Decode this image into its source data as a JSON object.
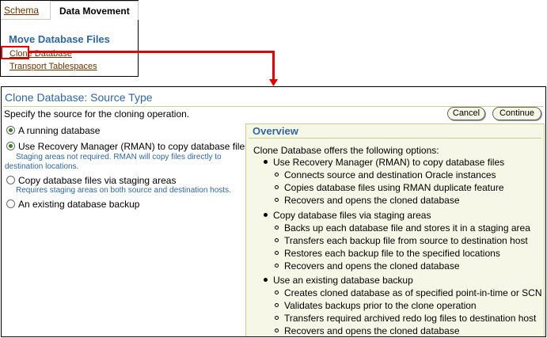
{
  "inset": {
    "tabs": [
      "Schema",
      "Data Movement"
    ],
    "heading": "Move Database Files",
    "links": [
      "Clone Database",
      "Transport Tablespaces"
    ]
  },
  "page": {
    "title": "Clone Database: Source Type",
    "instructions": "Specify the source for the cloning operation.",
    "buttons": {
      "cancel": "Cancel",
      "continue": "Continue"
    }
  },
  "options": [
    {
      "label": "A running database",
      "selected": true
    },
    {
      "label": "Use Recovery Manager (RMAN) to copy database files",
      "selected": true,
      "tip": [
        "Staging areas not required. RMAN will copy files directly to",
        "destination locations."
      ]
    },
    {
      "label": "Copy database files via staging areas",
      "selected": false,
      "tip": [
        "Requires staging areas on both source and destination hosts."
      ]
    },
    {
      "label": "An existing database backup",
      "selected": false
    }
  ],
  "overview": {
    "title": "Overview",
    "intro": "Clone Database offers the following options:",
    "sections": [
      {
        "label": "Use Recovery Manager (RMAN) to copy database files",
        "items": [
          "Connects source and destination Oracle instances",
          "Copies database files using RMAN duplicate feature",
          "Recovers and opens the cloned database"
        ]
      },
      {
        "label": "Copy database files via staging areas",
        "items": [
          "Backs up each database file and stores it in a staging area",
          "Transfers each backup file from source to destination host",
          "Restores each backup file to the specified locations",
          "Recovers and opens the cloned database"
        ]
      },
      {
        "label": "Use an existing database backup",
        "items": [
          "Creates cloned database as of specified point-in-time or SCN",
          "Validates backups prior to the clone operation",
          "Transfers required archived redo log files to destination host",
          "Recovers and opens the cloned database"
        ]
      }
    ]
  },
  "colors": {
    "title": "#336699",
    "link": "#663300",
    "highlight": "#e00000",
    "panel": "#f7f7e7"
  }
}
